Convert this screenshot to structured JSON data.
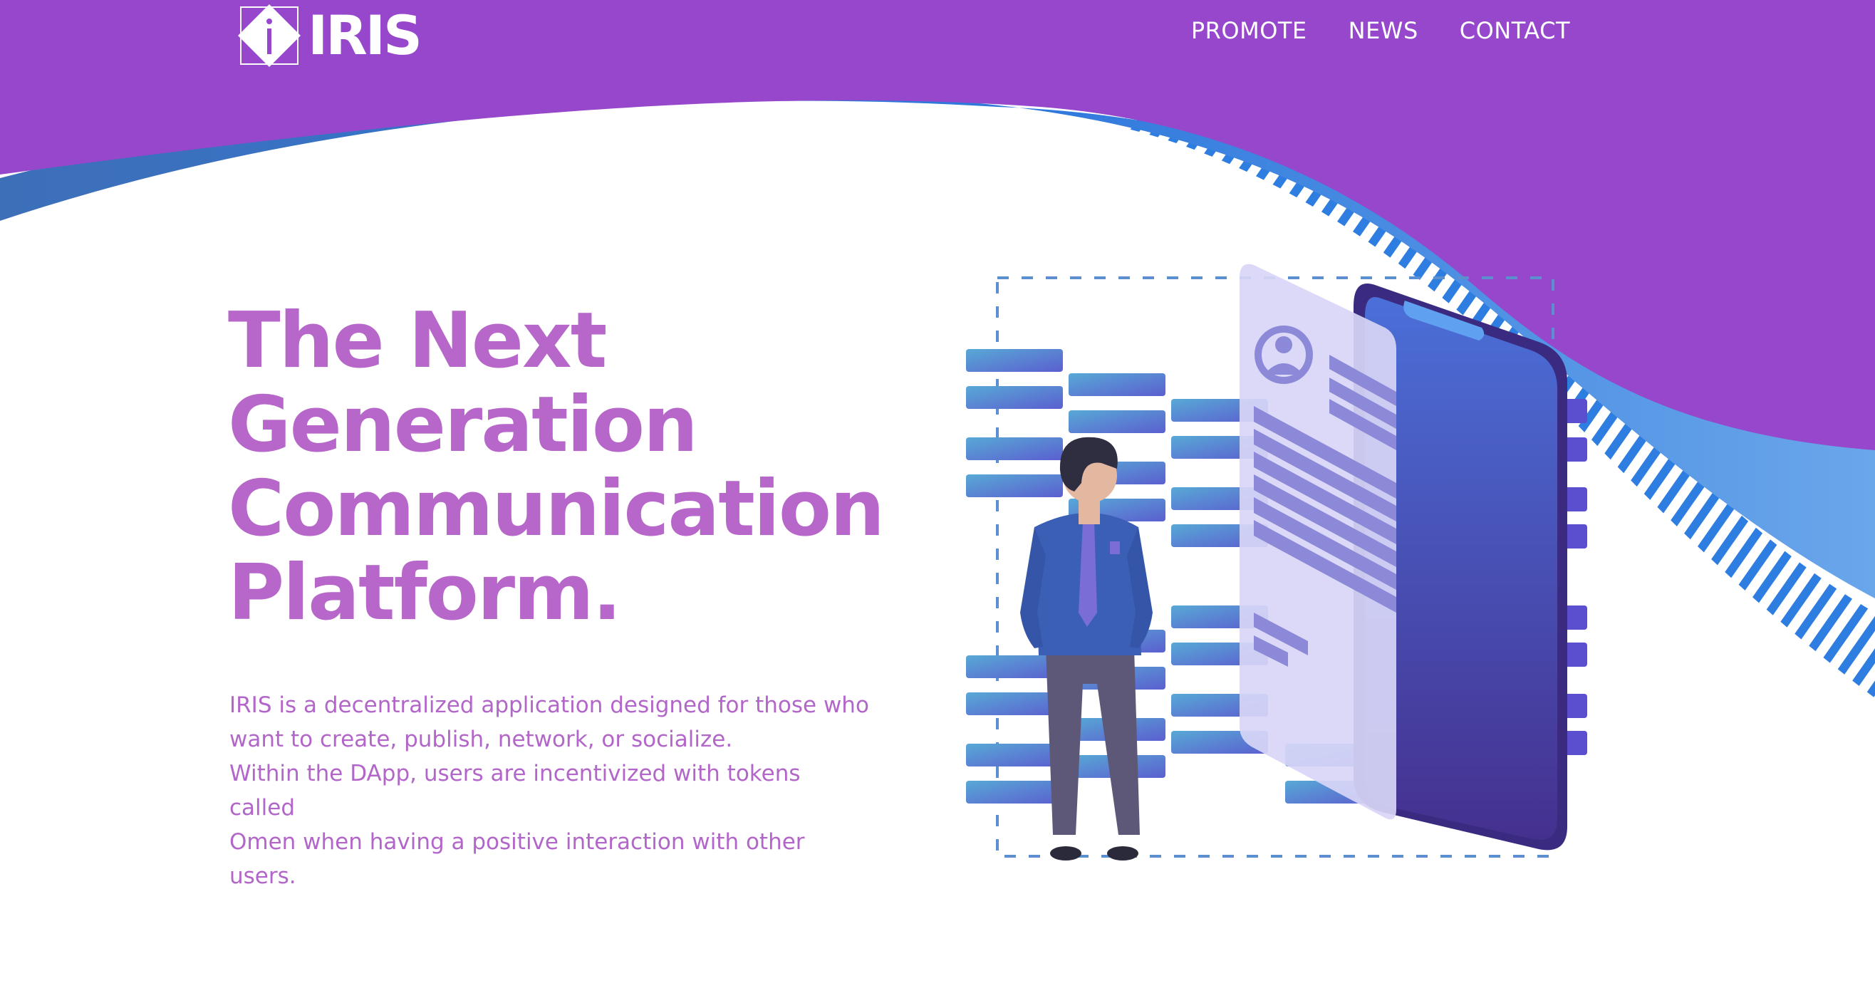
{
  "brand": {
    "name": "IRIS",
    "colors": {
      "header_purple": "#9747cc",
      "heading_purple": "#b766c9",
      "accent_blue": "#2d7ee0"
    }
  },
  "nav": {
    "items": [
      {
        "label": "PROMOTE"
      },
      {
        "label": "NEWS"
      },
      {
        "label": "CONTACT"
      }
    ]
  },
  "hero": {
    "title_lines": [
      "The Next",
      "Generation",
      "Communication",
      "Platform."
    ],
    "description_lines": [
      "IRIS is a decentralized application designed for those who",
      "want to create, publish, network, or socialize.",
      "Within the DApp, users are incentivized with tokens called",
      "Omen when having a positive interaction with other users."
    ]
  },
  "illustration": {
    "icons": [
      "person-figure",
      "smartphone-icon",
      "profile-card-icon",
      "user-avatar-icon",
      "data-bars"
    ]
  }
}
